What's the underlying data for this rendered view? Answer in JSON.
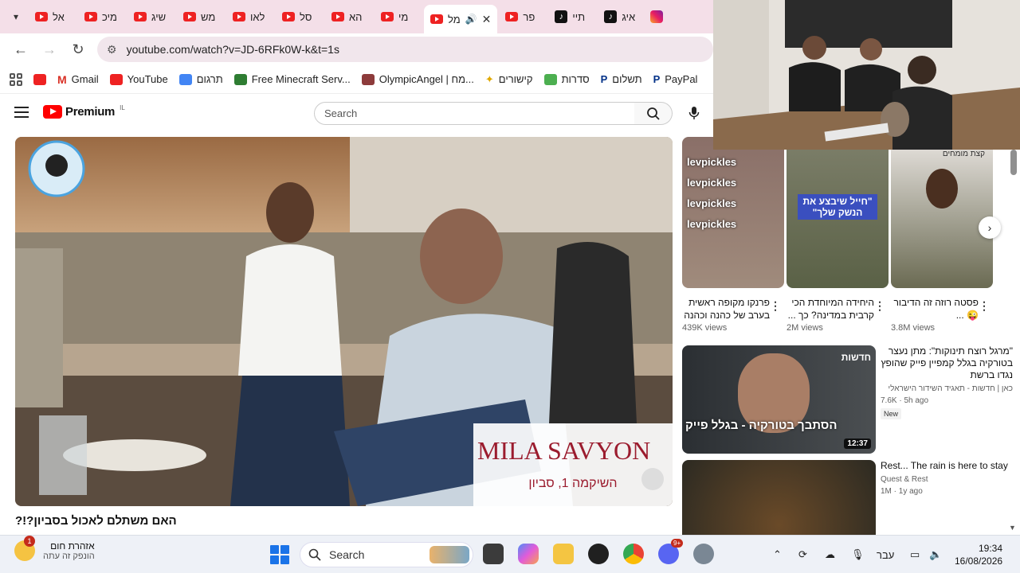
{
  "browser": {
    "tabs": [
      {
        "label": "אל",
        "icon": "youtube-icon"
      },
      {
        "label": "מיכ",
        "icon": "youtube-icon"
      },
      {
        "label": "שיג",
        "icon": "youtube-icon"
      },
      {
        "label": "מש",
        "icon": "youtube-icon"
      },
      {
        "label": "לאו",
        "icon": "youtube-icon"
      },
      {
        "label": "סל",
        "icon": "youtube-icon"
      },
      {
        "label": "הא",
        "icon": "youtube-icon"
      },
      {
        "label": "מי",
        "icon": "youtube-icon"
      },
      {
        "label": "מל",
        "icon": "youtube-icon"
      },
      {
        "label": "פר",
        "icon": "youtube-icon"
      },
      {
        "label": "תיי",
        "icon": "tiktok-icon"
      },
      {
        "label": "איג",
        "icon": "tiktok-icon"
      }
    ],
    "url": "youtube.com/watch?v=JD-6RFk0W-k&t=1s",
    "bookmarks": [
      {
        "label": "",
        "icon": "youtube-icon",
        "color": "#e22"
      },
      {
        "label": "Gmail",
        "icon": "gmail-icon",
        "color": "#d93025"
      },
      {
        "label": "YouTube",
        "icon": "youtube-icon",
        "color": "#e22"
      },
      {
        "label": "תרגום",
        "icon": "translate-icon",
        "color": "#4285f4"
      },
      {
        "label": "Free Minecraft Serv...",
        "icon": "minecraft-icon",
        "color": "#2e7d32"
      },
      {
        "label": "OlympicAngel | מח...",
        "icon": "avatar-icon",
        "color": "#8d3b3b"
      },
      {
        "label": "קישורים",
        "icon": "sparkle-icon",
        "color": "#f9a825"
      },
      {
        "label": "סדרות",
        "icon": "folder-icon",
        "color": "#4caf50"
      },
      {
        "label": "תשלום",
        "icon": "paypal-icon",
        "color": "#003087"
      },
      {
        "label": "PayPal",
        "icon": "paypal-icon",
        "color": "#003087"
      }
    ]
  },
  "youtube": {
    "logo_text": "Premium",
    "country": "IL",
    "search_placeholder": "Search",
    "video_title": "האם משתלם לאכול בסביון?!?",
    "player_sign_text": "MILA SAVYON",
    "player_sign_sub": "השיקמה 1, סביון",
    "shorts": [
      {
        "title": "פרנקו מקופה ראשית בערב של כהנה וכהנה",
        "views": "439K views",
        "overlay": "levpickles"
      },
      {
        "title": "היחידה המיוחדת הכי קרבית במדינה? כך ...",
        "views": "2M views",
        "overlay": "\"חייל שיבצע את הנשק שלך\""
      },
      {
        "title": "פסטה רוזה זה הדיבור 😜 ...",
        "views": "3.8M views",
        "overlay": "קצת מומחים"
      }
    ],
    "recommendations": [
      {
        "title": "\"מרגל רוצח תינוקות\": מתן נעצר בטורקיה בגלל קמפיין פייק שהופץ נגדו ברשת",
        "channel": "כאן | חדשות - תאגיד השידור הישראלי",
        "meta": "7.6K · 5h ago",
        "badge": "New",
        "duration": "12:37",
        "thumb_text": "הסתבך בטורקיה - בגלל פייק",
        "thumb_label": "חדשות"
      },
      {
        "title": "Rest... The rain is here to stay",
        "channel": "Quest & Rest",
        "meta": "1M · 1y ago"
      }
    ]
  },
  "taskbar": {
    "weather_title": "אזהרת חום",
    "weather_sub": "הונפק זה עתה",
    "weather_badge": "1",
    "search_label": "Search",
    "language": "עבר",
    "time": "19:34",
    "date": "16/08/2026",
    "discord_badge": "9+"
  }
}
